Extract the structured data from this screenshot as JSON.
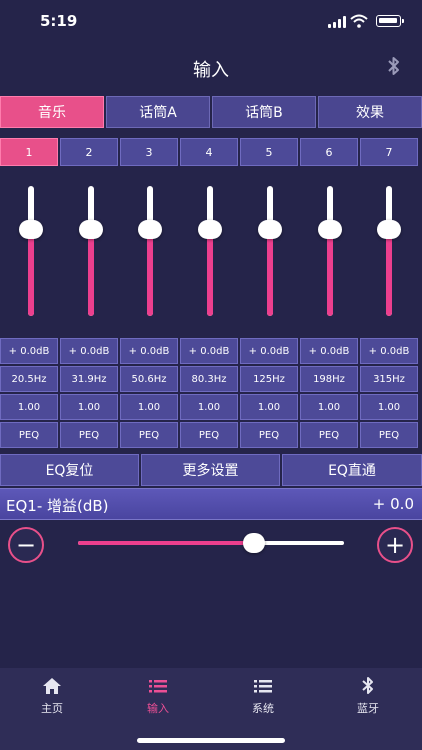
{
  "status": {
    "time": "5:19"
  },
  "header": {
    "title": "输入"
  },
  "tabs": [
    {
      "label": "音乐",
      "active": true
    },
    {
      "label": "话筒A",
      "active": false
    },
    {
      "label": "话筒B",
      "active": false
    },
    {
      "label": "效果",
      "active": false
    }
  ],
  "bands": [
    "1",
    "2",
    "3",
    "4",
    "5",
    "6",
    "7"
  ],
  "band_levels": [
    0.5,
    0.5,
    0.5,
    0.5,
    0.5,
    0.5,
    0.5
  ],
  "eq": {
    "gains": [
      "+ 0.0dB",
      "+ 0.0dB",
      "+ 0.0dB",
      "+ 0.0dB",
      "+ 0.0dB",
      "+ 0.0dB",
      "+ 0.0dB"
    ],
    "freqs": [
      "20.5Hz",
      "31.9Hz",
      "50.6Hz",
      "80.3Hz",
      "125Hz",
      "198Hz",
      "315Hz"
    ],
    "q": [
      "1.00",
      "1.00",
      "1.00",
      "1.00",
      "1.00",
      "1.00",
      "1.00"
    ],
    "types": [
      "PEQ",
      "PEQ",
      "PEQ",
      "PEQ",
      "PEQ",
      "PEQ",
      "PEQ"
    ]
  },
  "actions": {
    "reset": "EQ复位",
    "more": "更多设置",
    "bypass": "EQ直通"
  },
  "gain": {
    "label": "EQ1- 增益(dB)",
    "value": "+ 0.0",
    "level": 0.66
  },
  "controls": {
    "minus": "−",
    "plus": "+"
  },
  "nav": {
    "home": "主页",
    "input": "输入",
    "system": "系统",
    "bluetooth": "蓝牙"
  },
  "colors": {
    "accent": "#e8508a",
    "background": "#25244a",
    "cell": "#4d4a98"
  }
}
